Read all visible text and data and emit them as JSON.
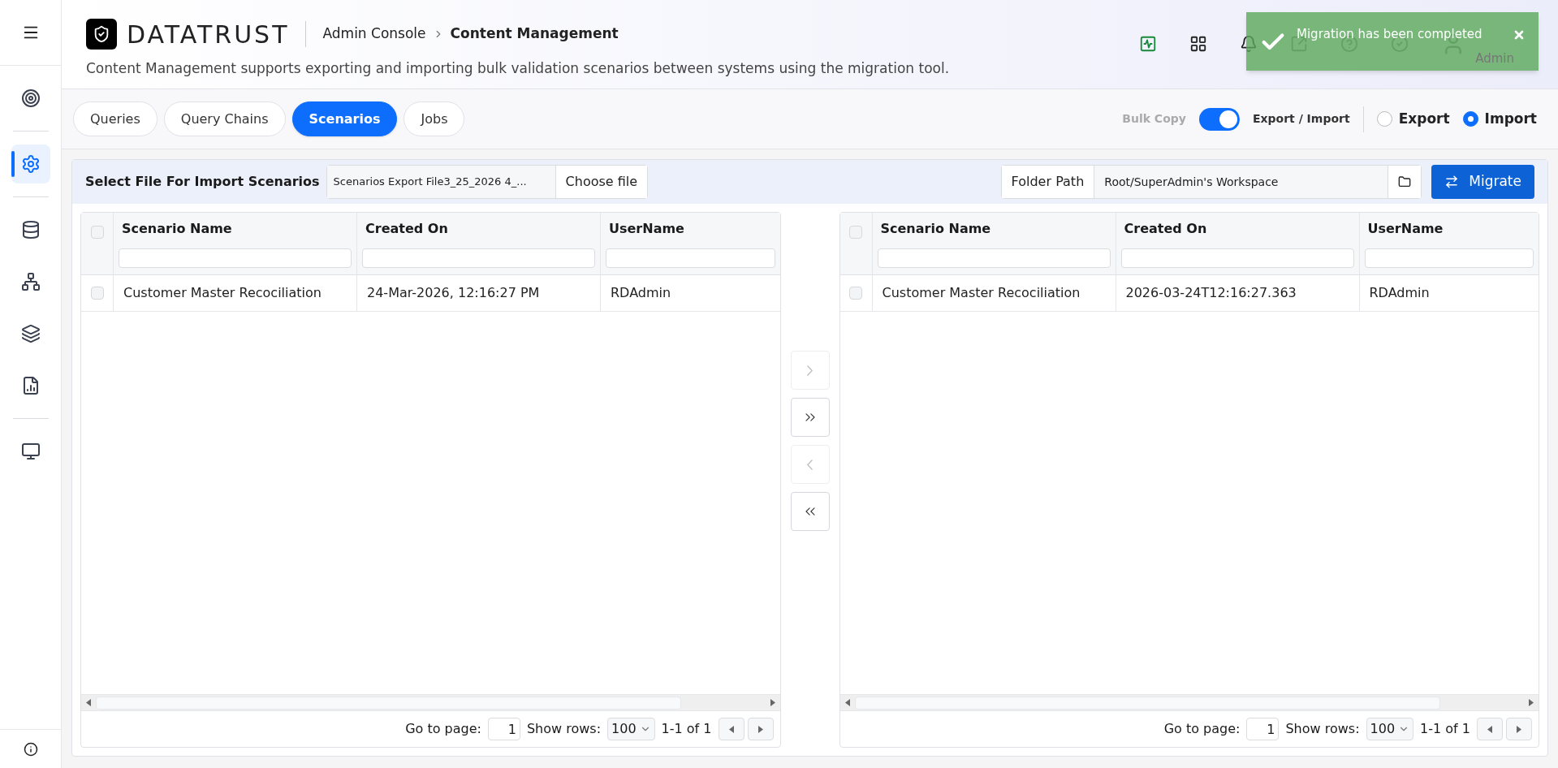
{
  "sidebar": {
    "items": [
      {
        "kind": "target",
        "selected": false
      },
      {
        "kind": "settings",
        "selected": true
      },
      {
        "kind": "database",
        "selected": false
      },
      {
        "kind": "flow",
        "selected": false
      },
      {
        "kind": "layers",
        "selected": false
      },
      {
        "kind": "report",
        "selected": false
      },
      {
        "kind": "monitor",
        "selected": false
      }
    ]
  },
  "header": {
    "logo": "DATATRUST",
    "breadcrumb": [
      "Admin Console",
      "Content Management"
    ],
    "description": "Content Management supports exporting and importing bulk validation scenarios between systems using the migration tool.",
    "user_role": "Admin"
  },
  "toast": {
    "message": "Migration has been completed"
  },
  "tabs": [
    {
      "label": "Queries",
      "selected": false
    },
    {
      "label": "Query Chains",
      "selected": false
    },
    {
      "label": "Scenarios",
      "selected": true
    },
    {
      "label": "Jobs",
      "selected": false
    }
  ],
  "bulk_copy": {
    "label": "Bulk Copy",
    "on": true,
    "mode_label": "Export / Import"
  },
  "direction": [
    {
      "label": "Export",
      "selected": false
    },
    {
      "label": "Import",
      "selected": true
    }
  ],
  "file_select": {
    "label": "Select File For Import Scenarios",
    "file_name": "Scenarios Export File3_25_2026 4_...",
    "button": "Choose file"
  },
  "folder": {
    "label": "Folder Path",
    "value": "Root/SuperAdmin's Workspace"
  },
  "migrate_button": "Migrate",
  "tables": [
    {
      "columns": [
        "Scenario Name",
        "Created On",
        "UserName"
      ],
      "all_checked": false,
      "rows": [
        {
          "checked": false,
          "cells": [
            "Customer Master Recociliation",
            "24-Mar-2026, 12:16:27 PM",
            "RDAdmin"
          ]
        }
      ],
      "pagination": {
        "go_to_label": "Go to page:",
        "page": "1",
        "show_rows_label": "Show rows:",
        "rows": "100",
        "range": "1-1 of 1"
      }
    },
    {
      "columns": [
        "Scenario Name",
        "Created On",
        "UserName"
      ],
      "all_checked": false,
      "rows": [
        {
          "checked": false,
          "cells": [
            "Customer Master Recociliation",
            "2026-03-24T12:16:27.363",
            "RDAdmin"
          ]
        }
      ],
      "pagination": {
        "go_to_label": "Go to page:",
        "page": "1",
        "show_rows_label": "Show rows:",
        "rows": "100",
        "range": "1-1 of 1"
      }
    }
  ],
  "transfer_buttons": [
    {
      "kind": "right",
      "disabled": true
    },
    {
      "kind": "all_right",
      "disabled": false
    },
    {
      "kind": "left",
      "disabled": true
    },
    {
      "kind": "all_left",
      "disabled": false
    }
  ]
}
